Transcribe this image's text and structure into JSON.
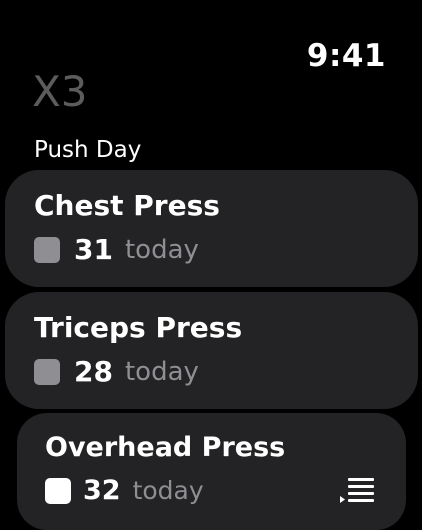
{
  "status": {
    "time": "9:41"
  },
  "app": {
    "title": "X3"
  },
  "section": {
    "title": "Push Day"
  },
  "exercises": [
    {
      "name": "Chest Press",
      "count": "31",
      "label": "today",
      "checked": false
    },
    {
      "name": "Triceps Press",
      "count": "28",
      "label": "today",
      "checked": false
    },
    {
      "name": "Overhead Press",
      "count": "32",
      "label": "today",
      "checked": false
    }
  ],
  "icons": {
    "checkbox_icon": "checkbox-icon",
    "list_icon": "list-icon"
  },
  "colors": {
    "background": "#000000",
    "card": "#232325",
    "muted_text": "#8e8e93",
    "title_text": "#5c5c5e",
    "checkbox_gray": "#8e8e93",
    "checkbox_white": "#ffffff"
  }
}
